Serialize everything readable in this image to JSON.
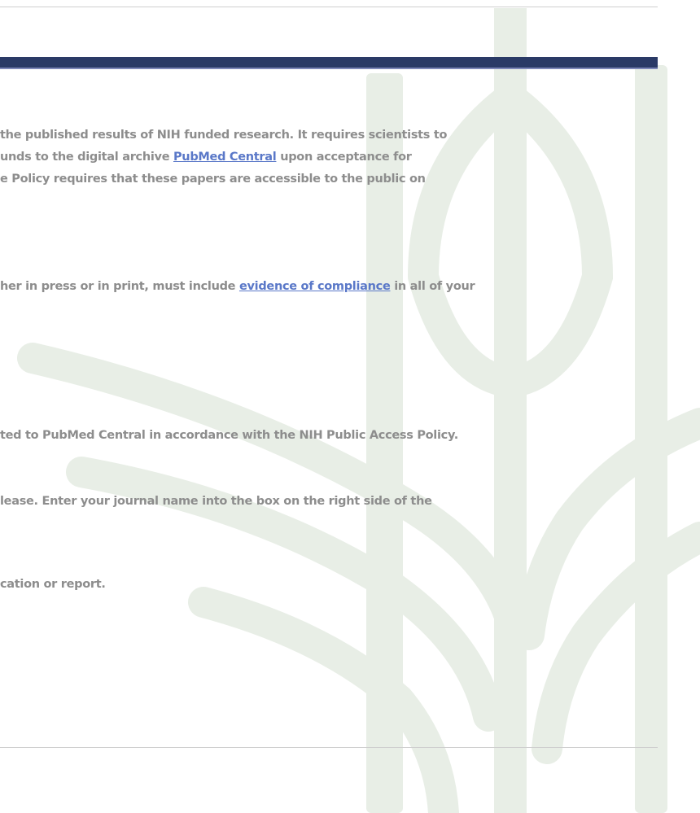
{
  "paragraph_1": {
    "line_1": "the published results of NIH funded research. It requires scientists to",
    "line_2_prefix": "unds to the digital archive ",
    "line_2_link": "PubMed Central",
    "line_2_suffix": " upon acceptance for",
    "line_3": "e Policy requires that these papers are accessible to the public on"
  },
  "paragraph_2": {
    "prefix": "her in press or in print, must include ",
    "link": "evidence of compliance",
    "suffix": " in all of your"
  },
  "paragraph_3": {
    "line_1": "ted to PubMed Central in accordance with the NIH Public Access Policy.",
    "line_2": "lease. Enter your journal name into the box on the right side of the",
    "line_3": "cation or report."
  },
  "colors": {
    "banner": "#2a3a66",
    "link": "#5a78c8",
    "watermark": "#e9efe7"
  },
  "watermark_icon": "wheat-sprout-icon"
}
